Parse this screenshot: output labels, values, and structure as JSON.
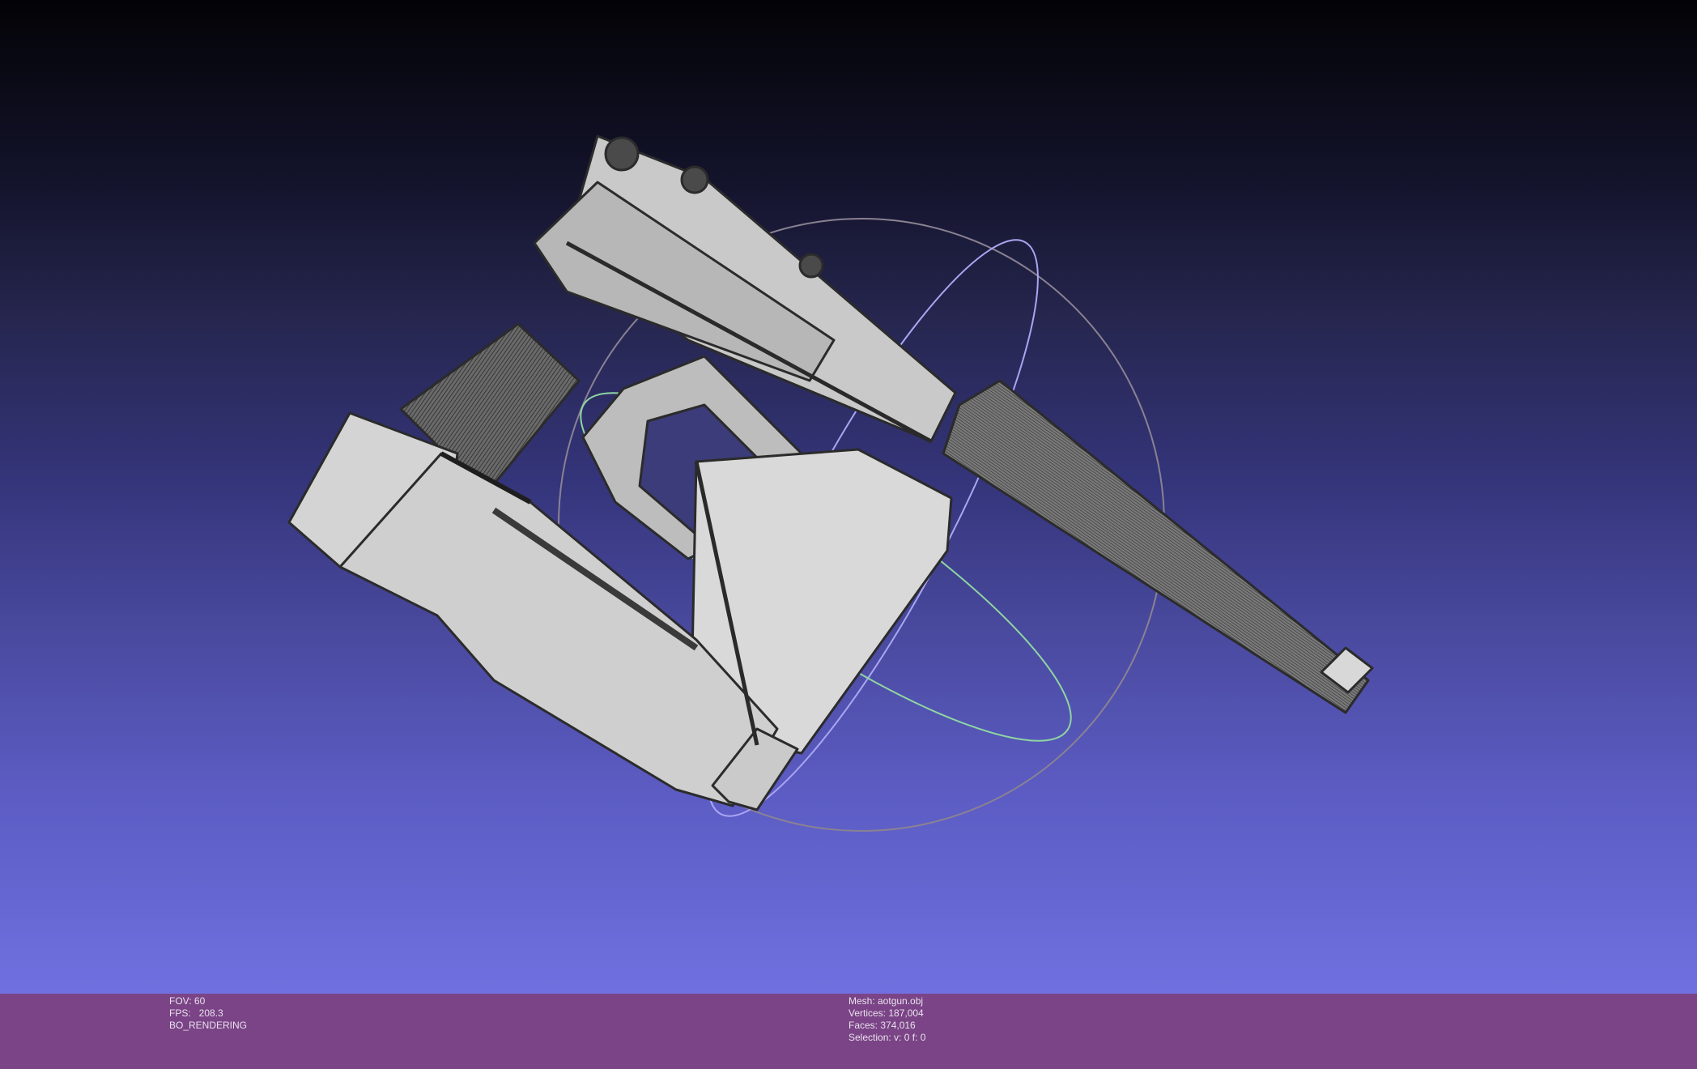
{
  "viewer": {
    "background_top": "#030306",
    "background_bottom": "#7070e0",
    "info_bar_color": "#7b4486"
  },
  "scene": {
    "model": "3d-pistol-mesh",
    "trackball": "trackball-gizmo"
  },
  "render_info": {
    "fov": "FOV: 60",
    "fps": "FPS:   208.3",
    "mode": "BO_RENDERING"
  },
  "mesh_info": {
    "mesh": "Mesh: aotgun.obj",
    "vertices": "Vertices: 187,004",
    "faces": "Faces: 374,016",
    "selection": "Selection: v: 0 f: 0"
  }
}
